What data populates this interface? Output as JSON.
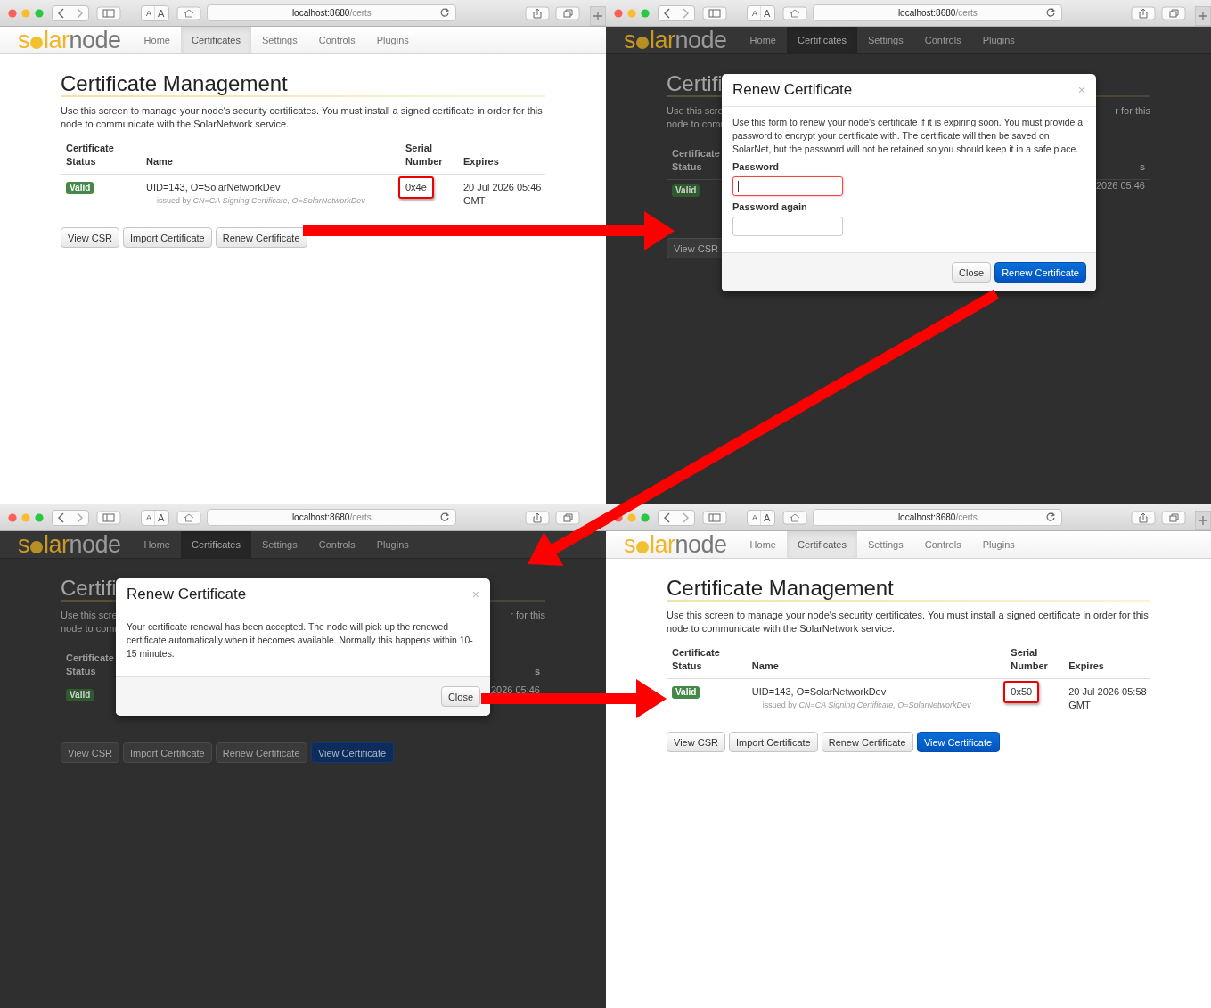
{
  "panels": [
    {
      "kind": "page",
      "url_host": "localhost:8680",
      "url_path": "/certs",
      "text_size": [
        "A",
        "A"
      ],
      "new_tab_button": true,
      "logo": {
        "start": "s",
        "middle": "lar",
        "end": "node"
      },
      "nav": [
        {
          "label": "Home",
          "selected": false
        },
        {
          "label": "Certificates",
          "selected": true
        },
        {
          "label": "Settings",
          "selected": false
        },
        {
          "label": "Controls",
          "selected": false
        },
        {
          "label": "Plugins",
          "selected": false
        }
      ],
      "heading": "Certificate Management",
      "description": "Use this screen to manage your node's security certificates. You must install a signed certificate in order for this node to communicate with the SolarNetwork service.",
      "columns": [
        "Certificate Status",
        "Name",
        "Serial Number",
        "Expires"
      ],
      "row": {
        "status": "Valid",
        "name": "UID=143, O=SolarNetworkDev",
        "issuer": "issued by *CN=CA Signing Certificate, O=SolarNetworkDev*",
        "serial": "0x4e",
        "serial_highlighted": true,
        "expires": "20 Jul 2026 05:46 GMT"
      },
      "buttons": [
        {
          "label": "View CSR",
          "kind": "default"
        },
        {
          "label": "Import Certificate",
          "kind": "default"
        },
        {
          "label": "Renew Certificate",
          "kind": "default"
        }
      ]
    },
    {
      "kind": "dialog",
      "url_host": "localhost:8680",
      "url_path": "/certs",
      "text_size": [
        "A",
        "A"
      ],
      "new_tab_button": true,
      "logo": {
        "start": "s",
        "middle": "lar",
        "end": "node"
      },
      "nav": [
        {
          "label": "Home",
          "selected": false
        },
        {
          "label": "Certificates",
          "selected": true
        },
        {
          "label": "Settings",
          "selected": false
        },
        {
          "label": "Controls",
          "selected": false
        },
        {
          "label": "Plugins",
          "selected": false
        }
      ],
      "background": {
        "heading": "Certifi",
        "lines": [
          {
            "left": "Use this scre",
            "right": "r for this"
          },
          {
            "left": "node to comr"
          }
        ],
        "header_left": "Certificate Status",
        "header_right": "s",
        "badge": "Valid",
        "cell_right": "2026 05:46",
        "buttons": [
          {
            "label": "View CSR",
            "kind": "default"
          }
        ]
      },
      "modal": {
        "title": "Renew Certificate",
        "close": "×",
        "text": "Use this form to renew your node's certificate if it is expiring soon. You must provide a password to encrypt your certificate with. The certificate will then be saved on SolarNet, but the password will not be retained so you should keep it in a safe place.",
        "fields": [
          {
            "label": "Password",
            "focused": true
          },
          {
            "label": "Password again",
            "focused": false
          }
        ],
        "buttons": [
          {
            "label": "Close",
            "kind": "default"
          },
          {
            "label": "Renew Certificate",
            "kind": "primary"
          }
        ]
      }
    },
    {
      "kind": "dialog",
      "url_host": "localhost:8680",
      "url_path": "/certs",
      "text_size": [
        "A",
        "A"
      ],
      "new_tab_button": false,
      "logo": {
        "start": "s",
        "middle": "lar",
        "end": "node"
      },
      "nav": [
        {
          "label": "Home",
          "selected": false
        },
        {
          "label": "Certificates",
          "selected": true
        },
        {
          "label": "Settings",
          "selected": false
        },
        {
          "label": "Controls",
          "selected": false
        },
        {
          "label": "Plugins",
          "selected": false
        }
      ],
      "background": {
        "heading": "Certifi",
        "lines": [
          {
            "left": "Use this scre",
            "right": "r for this"
          },
          {
            "left": "node to comr"
          }
        ],
        "header_left": "Certificate Status",
        "header_right": "s",
        "badge": "Valid",
        "cell_right": "2026 05:46",
        "buttons": [
          {
            "label": "View CSR",
            "kind": "default"
          },
          {
            "label": "Import Certificate",
            "kind": "default"
          },
          {
            "label": "Renew Certificate",
            "kind": "default"
          },
          {
            "label": "View Certificate",
            "kind": "primary"
          }
        ]
      },
      "modal": {
        "title": "Renew Certificate",
        "close": "×",
        "text": "Your certificate renewal has been accepted. The node will pick up the renewed certificate automatically when it becomes available. Normally this happens within 10-15 minutes.",
        "buttons": [
          {
            "label": "Close",
            "kind": "default"
          }
        ]
      }
    },
    {
      "kind": "page",
      "url_host": "localhost:8680",
      "url_path": "/certs",
      "text_size": [
        "A",
        "A"
      ],
      "new_tab_button": true,
      "logo": {
        "start": "s",
        "middle": "lar",
        "end": "node"
      },
      "nav": [
        {
          "label": "Home",
          "selected": false
        },
        {
          "label": "Certificates",
          "selected": true
        },
        {
          "label": "Settings",
          "selected": false
        },
        {
          "label": "Controls",
          "selected": false
        },
        {
          "label": "Plugins",
          "selected": false
        }
      ],
      "heading": "Certificate Management",
      "description": "Use this screen to manage your node's security certificates. You must install a signed certificate in order for this node to communicate with the SolarNetwork service.",
      "columns": [
        "Certificate Status",
        "Name",
        "Serial Number",
        "Expires"
      ],
      "row": {
        "status": "Valid",
        "name": "UID=143, O=SolarNetworkDev",
        "issuer": "issued by *CN=CA Signing Certificate, O=SolarNetworkDev*",
        "serial": "0x50",
        "serial_highlighted": true,
        "expires": "20 Jul 2026 05:58 GMT"
      },
      "buttons": [
        {
          "label": "View CSR",
          "kind": "default"
        },
        {
          "label": "Import Certificate",
          "kind": "default"
        },
        {
          "label": "Renew Certificate",
          "kind": "default"
        },
        {
          "label": "View Certificate",
          "kind": "primary"
        }
      ]
    }
  ],
  "arrows": [
    {
      "kind": "to_dialog"
    },
    {
      "kind": "to_result"
    },
    {
      "kind": "to_final"
    }
  ]
}
